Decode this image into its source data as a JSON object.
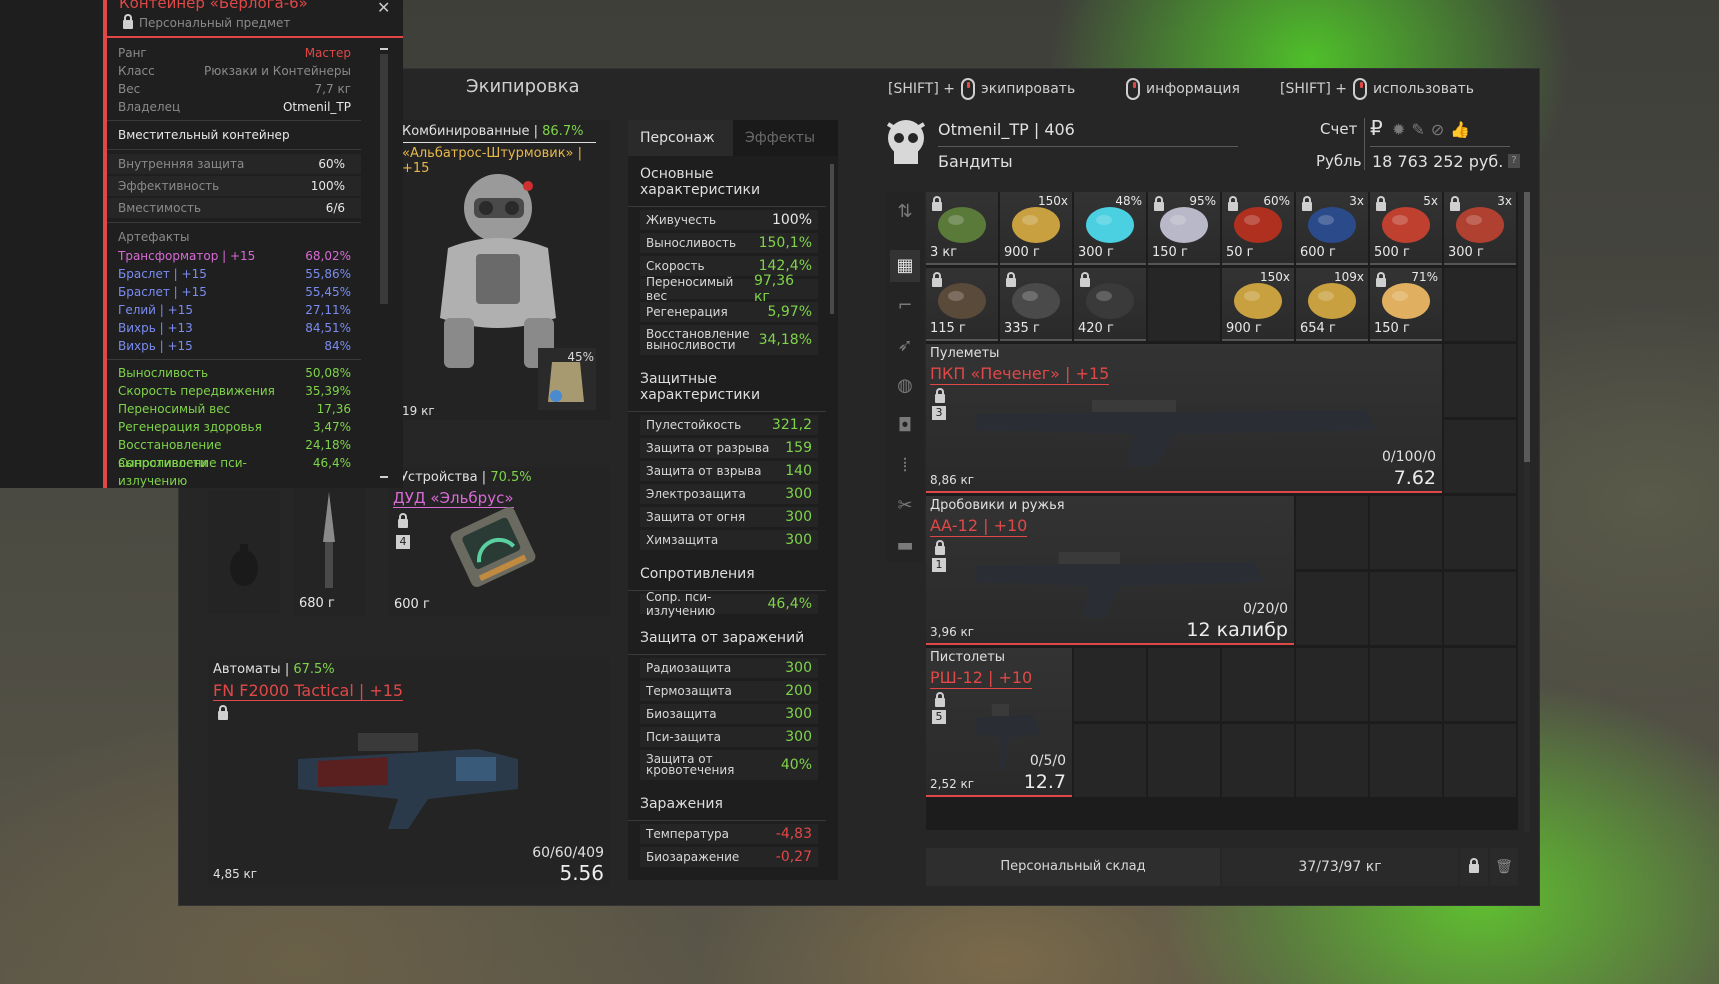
{
  "window": {
    "title": "Экипировка",
    "hints": [
      {
        "prefix": "[SHIFT] +",
        "label": "экипировать"
      },
      {
        "prefix": "",
        "label": "информация"
      },
      {
        "prefix": "[SHIFT] +",
        "label": "использовать"
      }
    ]
  },
  "tooltip": {
    "title": "Контейнер «Берлога-6»",
    "subtitle": "Персональный предмет",
    "info": [
      {
        "k": "Ранг",
        "v": "Мастер"
      },
      {
        "k": "Класс",
        "v": "Рюкзаки и Контейнеры"
      },
      {
        "k": "Вес",
        "v": "7,7 кг"
      },
      {
        "k": "Владелец",
        "v": "Otmenil_TP"
      }
    ],
    "section": "Вместительный контейнер",
    "props": [
      {
        "k": "Внутренняя защита",
        "v": "60%"
      },
      {
        "k": "Эффективность",
        "v": "100%"
      },
      {
        "k": "Вместимость",
        "v": "6/6"
      }
    ],
    "artifacts_title": "Артефакты",
    "artifacts": [
      {
        "k": "Трансформатор | +15",
        "v": "68,02%",
        "color": "pink"
      },
      {
        "k": "Браслет | +15",
        "v": "55,86%",
        "color": "blue"
      },
      {
        "k": "Браслет | +15",
        "v": "55,45%",
        "color": "blue"
      },
      {
        "k": "Гелий | +15",
        "v": "27,11%",
        "color": "blue"
      },
      {
        "k": "Вихрь | +13",
        "v": "84,51%",
        "color": "blue"
      },
      {
        "k": "Вихрь | +15",
        "v": "84%",
        "color": "blue"
      }
    ],
    "bonuses": [
      {
        "k": "Выносливость",
        "v": "50,08%"
      },
      {
        "k": "Скорость передвижения",
        "v": "35,39%"
      },
      {
        "k": "Переносимый вес",
        "v": "17,36"
      },
      {
        "k": "Регенерация здоровья",
        "v": "3,47%"
      },
      {
        "k": "Восстановление выносливости",
        "v": "24,18%"
      },
      {
        "k": "Сопротивление пси-излучению",
        "v": "46,4%"
      }
    ]
  },
  "armor": {
    "label_prefix": "Комбинированные |",
    "label_pct": "86.7%",
    "name": "«Альбатрос-Штурмовик» | +15",
    "weight": "19 кг",
    "sub_pct": "45%"
  },
  "device": {
    "label_prefix": "Устройства |",
    "label_pct": "70.5%",
    "name": "ДУД «Эльбрус»",
    "lock_num": "4",
    "price": "600 г"
  },
  "knife": {
    "price": "680 г"
  },
  "rifle": {
    "label_prefix": "Автоматы |",
    "label_pct": "67.5%",
    "name": "FN F2000 Tactical | +15",
    "weight": "4,85 кг",
    "ammo": "60/60/409",
    "caliber": "5.56"
  },
  "stats": {
    "tabs": [
      "Персонаж",
      "Эффекты"
    ],
    "main_title": "Основные характеристики",
    "main": [
      {
        "k": "Живучесть",
        "v": "100%",
        "c": "w"
      },
      {
        "k": "Выносливость",
        "v": "150,1%",
        "c": "g"
      },
      {
        "k": "Скорость",
        "v": "142,4%",
        "c": "g"
      },
      {
        "k": "Переносимый вес",
        "v": "97,36 кг",
        "c": "g"
      },
      {
        "k": "Регенерация",
        "v": "5,97%",
        "c": "g"
      },
      {
        "k": "Восстановление выносливости",
        "v": "34,18%",
        "c": "g",
        "tall": true
      }
    ],
    "def_title": "Защитные характеристики",
    "def": [
      {
        "k": "Пулестойкость",
        "v": "321,2",
        "c": "g"
      },
      {
        "k": "Защита от разрыва",
        "v": "159",
        "c": "g"
      },
      {
        "k": "Защита от взрыва",
        "v": "140",
        "c": "g"
      },
      {
        "k": "Электрозащита",
        "v": "300",
        "c": "g"
      },
      {
        "k": "Защита от огня",
        "v": "300",
        "c": "g"
      },
      {
        "k": "Химзащита",
        "v": "300",
        "c": "g"
      }
    ],
    "res_title": "Сопротивления",
    "res": [
      {
        "k": "Сопр. пси-излучению",
        "v": "46,4%",
        "c": "g"
      }
    ],
    "cont_title": "Защита от заражений",
    "cont": [
      {
        "k": "Радиозащита",
        "v": "300",
        "c": "g"
      },
      {
        "k": "Термозащита",
        "v": "200",
        "c": "g"
      },
      {
        "k": "Биозащита",
        "v": "300",
        "c": "g"
      },
      {
        "k": "Пси-защита",
        "v": "300",
        "c": "g"
      },
      {
        "k": "Защита от кровотечения",
        "v": "40%",
        "c": "g",
        "tall": true
      }
    ],
    "inf_title": "Заражения",
    "inf": [
      {
        "k": "Температура",
        "v": "-4,83",
        "c": "r"
      },
      {
        "k": "Биозаражение",
        "v": "-0,27",
        "c": "r"
      }
    ]
  },
  "profile": {
    "name": "Otmenil_TP | 406",
    "faction": "Бандиты",
    "account_label": "Счет",
    "currency_label": "Рубль",
    "balance": "18 763 252 руб.",
    "currency_symbol": "₽"
  },
  "inventory": {
    "row1": [
      {
        "price": "3 кг",
        "count": "",
        "lock": true
      },
      {
        "price": "900 г",
        "count": "150x",
        "lock": false
      },
      {
        "price": "300 г",
        "count": "48%",
        "lock": false
      },
      {
        "price": "150 г",
        "count": "95%",
        "lock": true
      },
      {
        "price": "50 г",
        "count": "60%",
        "lock": true
      },
      {
        "price": "600 г",
        "count": "3x",
        "lock": true
      },
      {
        "price": "500 г",
        "count": "5x",
        "lock": true
      },
      {
        "price": "300 г",
        "count": "3x",
        "lock": true
      }
    ],
    "row2": [
      {
        "price": "115 г",
        "count": "",
        "lock": true
      },
      {
        "price": "335 г",
        "count": "",
        "lock": true
      },
      {
        "price": "420 г",
        "count": "",
        "lock": true
      },
      {
        "price": "",
        "count": "",
        "lock": false
      },
      {
        "price": "900 г",
        "count": "150x",
        "lock": false
      },
      {
        "price": "654 г",
        "count": "109x",
        "lock": false
      },
      {
        "price": "150 г",
        "count": "71%",
        "lock": true
      }
    ],
    "weapons": [
      {
        "cat": "Пулеметы",
        "name": "ПКП «Печенег» | +15",
        "lock_num": "3",
        "weight": "8,86 кг",
        "ammo": "0/100/0",
        "caliber": "7.62"
      },
      {
        "cat": "Дробовики и ружья",
        "name": "АА-12 | +10",
        "lock_num": "1",
        "weight": "3,96 кг",
        "ammo": "0/20/0",
        "caliber": "12 калибр"
      },
      {
        "cat": "Пистолеты",
        "name": "РШ-12 | +10",
        "lock_num": "5",
        "weight": "2,52 кг",
        "ammo": "0/5/0",
        "caliber": "12.7"
      }
    ]
  },
  "footer": {
    "storage": "Персональный склад",
    "weight": "37/73/97 кг"
  },
  "colors": {
    "accent": "#e04848",
    "positive": "#7fd44a",
    "bg": "#262626"
  }
}
